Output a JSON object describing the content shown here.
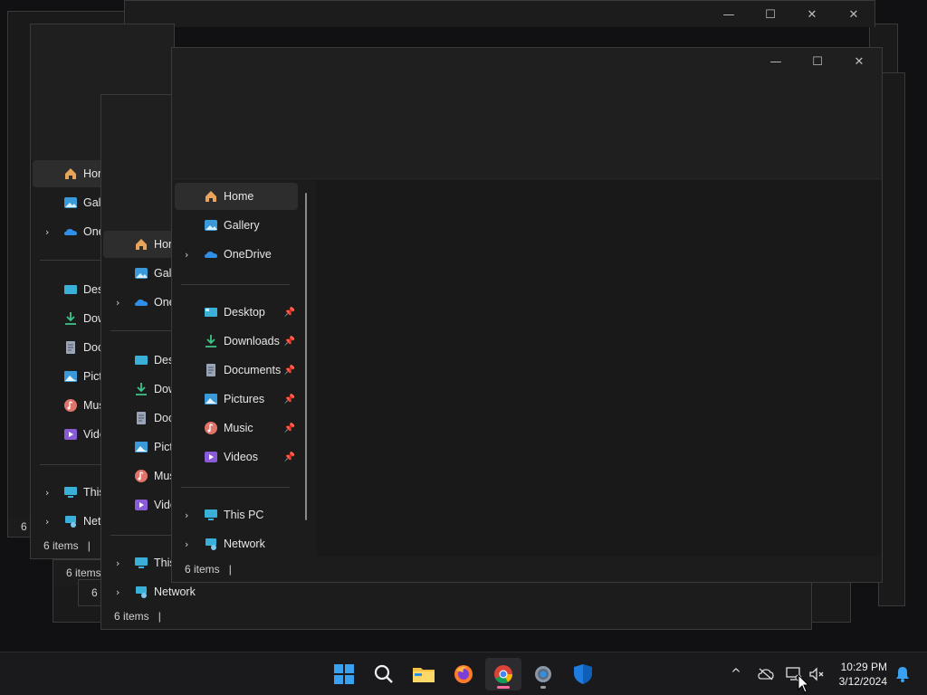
{
  "windows": {
    "caption": {
      "minimize": "—",
      "maximize": "☐",
      "close": "✕"
    },
    "status_items": "6 items",
    "status_sep": "|"
  },
  "nav": {
    "home": "Home",
    "gallery": "Gallery",
    "onedrive": "OneDrive",
    "desktop": "Desktop",
    "downloads": "Downloads",
    "documents": "Documents",
    "pictures": "Pictures",
    "music": "Music",
    "videos": "Videos",
    "thispc": "This PC",
    "network": "Network",
    "pin": "📌",
    "chevron": "›"
  },
  "back_windows": {
    "w1": {
      "home": "Hom",
      "gallery": "Galle",
      "onedrive": "One",
      "desktop": "Desk",
      "downloads": "Dow",
      "documents": "Docu",
      "pictures": "Pictu",
      "music": "Musi",
      "videos": "Vide",
      "thispc": "This",
      "network": "Netw"
    },
    "w2": {
      "home": "Hom",
      "gallery": "Galle",
      "onedrive": "One",
      "desktop": "Desk",
      "downloads": "Dow",
      "documents": "Docu",
      "pictures": "Pictu",
      "music": "Mus",
      "videos": "Vide",
      "thispc": "This",
      "network": "Network"
    }
  },
  "taskbar": {
    "apps": [
      "start-button",
      "search-button",
      "file-explorer",
      "firefox",
      "chrome",
      "settings",
      "defender"
    ],
    "tray_overflow": "^",
    "clock_time": "10:29 PM",
    "clock_date": "3/12/2024"
  },
  "colors": {
    "accent": "#0078d4",
    "folder": "#f5c242",
    "chrome_active_dot": "#ff6b9a"
  }
}
